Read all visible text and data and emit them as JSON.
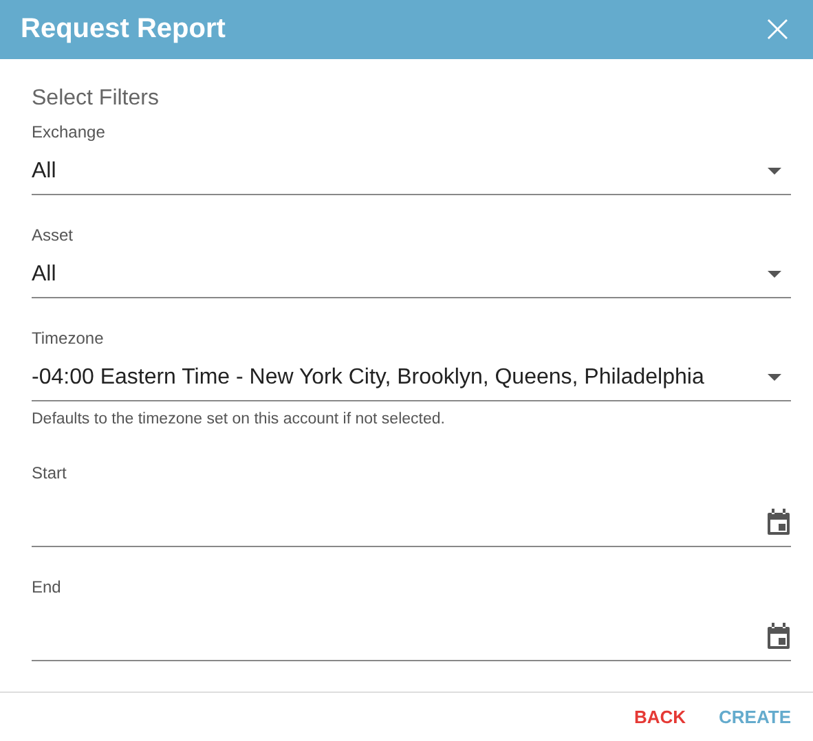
{
  "dialog": {
    "title": "Request Report",
    "close": "×"
  },
  "section_title": "Select Filters",
  "fields": [
    {
      "kind": "select",
      "label": "Exchange",
      "value": "All"
    },
    {
      "kind": "select",
      "label": "Asset",
      "value": "All"
    },
    {
      "kind": "select",
      "label": "Timezone",
      "value": "-04:00 Eastern Time - New York City, Brooklyn, Queens, Philadelphia",
      "helper": "Defaults to the timezone set on this account if not selected."
    },
    {
      "kind": "date",
      "label": "Start"
    },
    {
      "kind": "date",
      "label": "End"
    }
  ],
  "buttons": [
    {
      "label": "BACK",
      "kind": "cancel"
    },
    {
      "label": "CREATE",
      "kind": "primary"
    }
  ]
}
